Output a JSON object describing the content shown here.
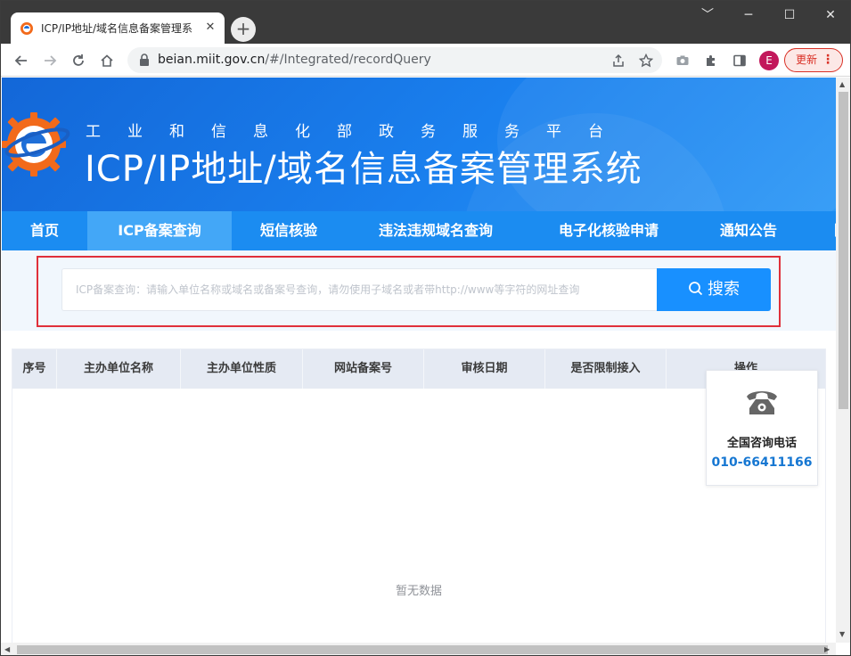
{
  "browser": {
    "tab_title": "ICP/IP地址/域名信息备案管理系",
    "tab_close": "✕",
    "new_tab": "+",
    "window_controls": {
      "minimize": "﹀",
      "restore": "─",
      "maximize": "☐",
      "close": "✕"
    },
    "url_host": "beian.miit.gov.cn",
    "url_path": "/#/Integrated/recordQuery",
    "profile_initial": "E",
    "update_label": "更新",
    "update_menu": "⋮"
  },
  "header": {
    "subtitle": "工业和信息化部政务服务平台",
    "title": "ICP/IP地址/域名信息备案管理系统"
  },
  "nav": {
    "items": [
      {
        "label": "首页"
      },
      {
        "label": "ICP备案查询"
      },
      {
        "label": "短信核验"
      },
      {
        "label": "违法违规域名查询"
      },
      {
        "label": "电子化核验申请"
      },
      {
        "label": "通知公告"
      },
      {
        "label": "ㅣ"
      }
    ],
    "active_index": 1
  },
  "search": {
    "placeholder": "ICP备案查询：请输入单位名称或域名或备案号查询，请勿使用子域名或者带http://www等字符的网址查询",
    "button_label": "搜索"
  },
  "table": {
    "columns": [
      "序号",
      "主办单位名称",
      "主办单位性质",
      "网站备案号",
      "审核日期",
      "是否限制接入",
      "操作"
    ],
    "empty_text": "暂无数据"
  },
  "contact": {
    "label": "全国咨询电话",
    "phone": "010-66411166"
  },
  "colors": {
    "header_blue": "#1a80ee",
    "nav_blue": "#1b8cf1",
    "nav_active": "#43a7f7",
    "search_button": "#1890ff",
    "highlight_red": "#e0303a",
    "phone_blue": "#1677d2"
  }
}
